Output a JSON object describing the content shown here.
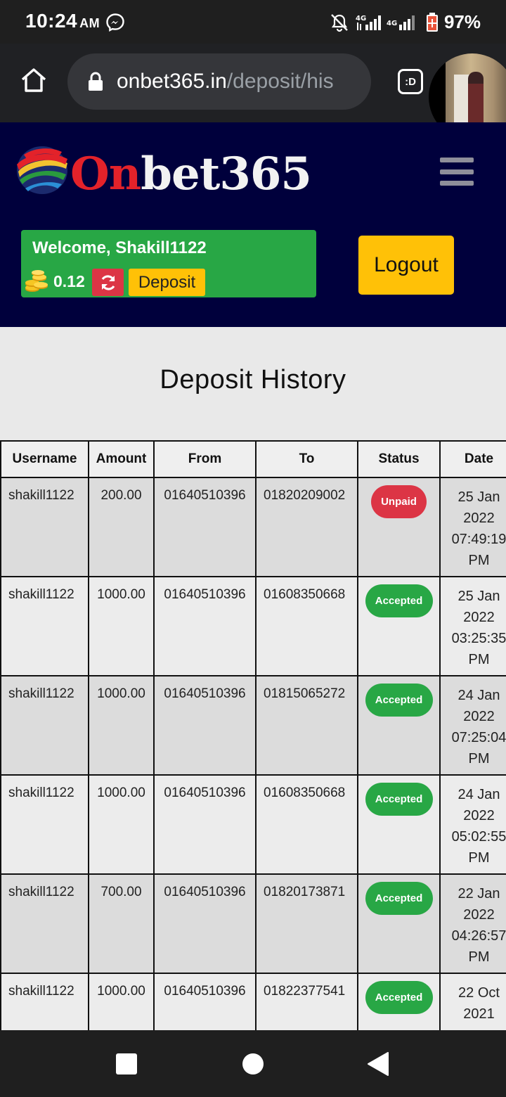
{
  "status_bar": {
    "time": "10:24",
    "ampm": "AM",
    "battery": "97%",
    "icons": [
      "messenger-icon",
      "mute-icon",
      "signal-4g-icon",
      "battery-saver-icon"
    ]
  },
  "browser": {
    "url_domain": "onbet365.in",
    "url_path": "/deposit/his",
    "tab_label": ":D"
  },
  "header": {
    "logo_red": "On",
    "logo_white": "bet365",
    "welcome": "Welcome, Shakill1122",
    "balance": "0.12",
    "deposit_label": "Deposit",
    "logout_label": "Logout"
  },
  "page": {
    "title": "Deposit History"
  },
  "table": {
    "headers": {
      "username": "Username",
      "amount": "Amount",
      "from": "From",
      "to": "To",
      "status": "Status",
      "date": "Date"
    },
    "rows": [
      {
        "username": "shakill1122",
        "amount": "200.00",
        "from": "01640510396",
        "to": "01820209002",
        "status": "Unpaid",
        "date_day": "25 Jan",
        "date_year": "2022",
        "date_time": "07:49:19",
        "date_ampm": "PM"
      },
      {
        "username": "shakill1122",
        "amount": "1000.00",
        "from": "01640510396",
        "to": "01608350668",
        "status": "Accepted",
        "date_day": "25 Jan",
        "date_year": "2022",
        "date_time": "03:25:35",
        "date_ampm": "PM"
      },
      {
        "username": "shakill1122",
        "amount": "1000.00",
        "from": "01640510396",
        "to": "01815065272",
        "status": "Accepted",
        "date_day": "24 Jan",
        "date_year": "2022",
        "date_time": "07:25:04",
        "date_ampm": "PM"
      },
      {
        "username": "shakill1122",
        "amount": "1000.00",
        "from": "01640510396",
        "to": "01608350668",
        "status": "Accepted",
        "date_day": "24 Jan",
        "date_year": "2022",
        "date_time": "05:02:55",
        "date_ampm": "PM"
      },
      {
        "username": "shakill1122",
        "amount": "700.00",
        "from": "01640510396",
        "to": "01820173871",
        "status": "Accepted",
        "date_day": "22 Jan",
        "date_year": "2022",
        "date_time": "04:26:57",
        "date_ampm": "PM"
      },
      {
        "username": "shakill1122",
        "amount": "1000.00",
        "from": "01640510396",
        "to": "01822377541",
        "status": "Accepted",
        "date_day": "22 Oct",
        "date_year": "2021",
        "date_time": "",
        "date_ampm": ""
      }
    ]
  },
  "colors": {
    "header_bg": "#00003c",
    "success": "#28a745",
    "danger": "#dc3545",
    "warning": "#ffc107"
  }
}
